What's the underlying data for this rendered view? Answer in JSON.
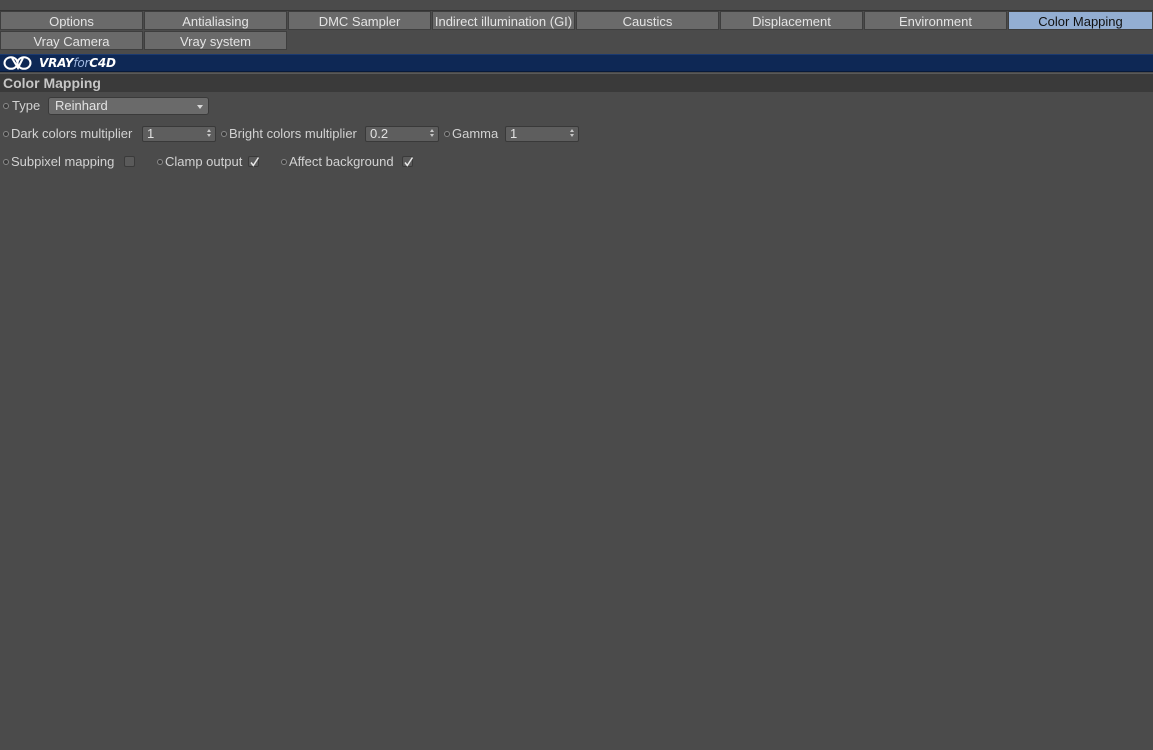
{
  "tabs": {
    "row1": [
      "Options",
      "Antialiasing",
      "DMC Sampler",
      "Indirect illumination (GI)",
      "Caustics",
      "Displacement",
      "Environment",
      "Color Mapping"
    ],
    "row2": [
      "Vray Camera",
      "Vray system"
    ],
    "active": "Color Mapping"
  },
  "banner": {
    "logo_vray": "VRAY",
    "logo_for": "for",
    "logo_c4d": "C4D"
  },
  "section": {
    "title": "Color Mapping"
  },
  "fields": {
    "type": {
      "label": "Type",
      "value": "Reinhard"
    },
    "dark_mult": {
      "label": "Dark colors multiplier",
      "value": "1"
    },
    "bright_mult": {
      "label": "Bright colors multiplier",
      "value": "0.2"
    },
    "gamma": {
      "label": "Gamma",
      "value": "1"
    },
    "subpixel": {
      "label": "Subpixel mapping",
      "checked": false
    },
    "clamp": {
      "label": "Clamp output",
      "checked": true
    },
    "affect_bg": {
      "label": "Affect background",
      "checked": true
    }
  },
  "colors": {
    "background": "#4b4b4b",
    "tab": "#6a6a6a",
    "tab_active": "#93aed2",
    "banner": "#0e2855",
    "section_header": "#3a3a3a"
  }
}
